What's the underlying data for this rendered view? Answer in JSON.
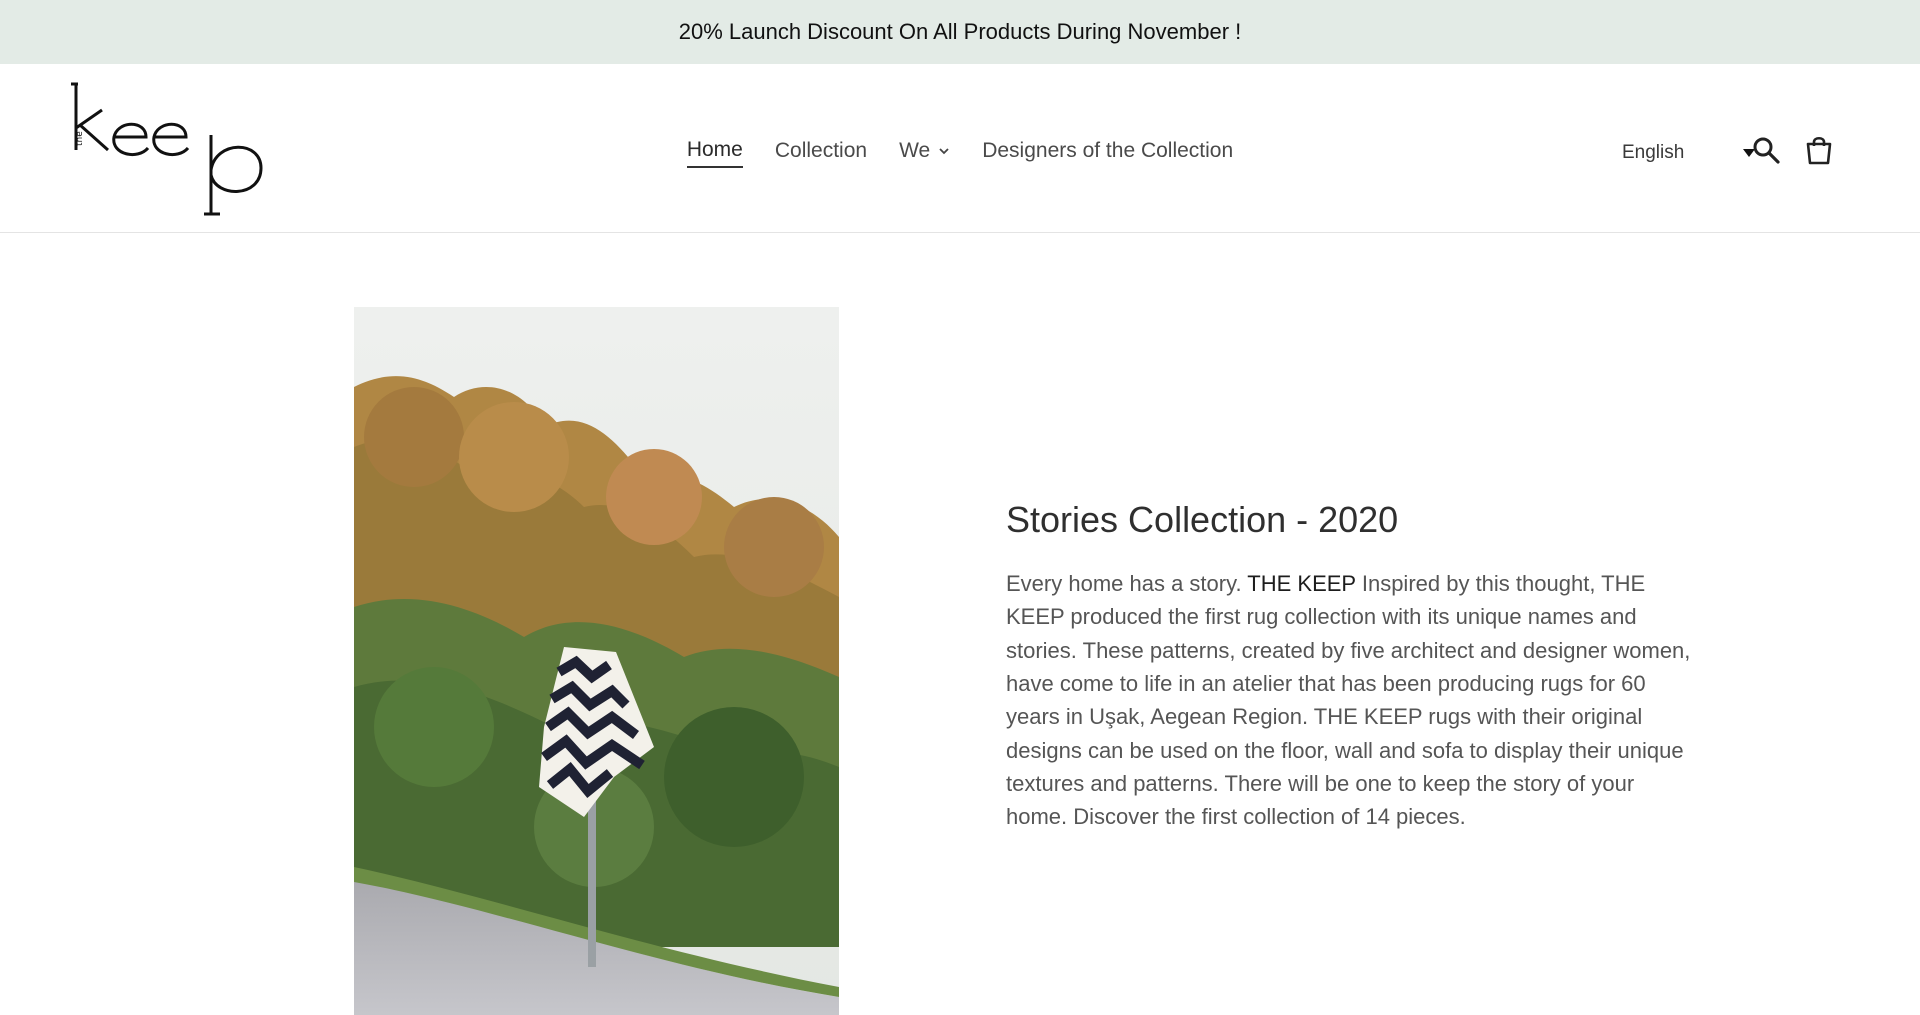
{
  "announcement": {
    "text": "20% Launch Discount On All Products During November !"
  },
  "header": {
    "logo_text": "the keep",
    "nav": [
      {
        "label": "Home",
        "active": true
      },
      {
        "label": "Collection"
      },
      {
        "label": "We",
        "has_dropdown": true
      },
      {
        "label": "Designers of the Collection"
      }
    ],
    "language": "English",
    "icons": [
      "search-icon",
      "cart-icon"
    ]
  },
  "main": {
    "title": "Stories Collection - 2020",
    "body_intro": "Every home has a story.",
    "body_brand": "THE KEEP",
    "body_rest": "Inspired by this thought, THE KEEP produced the first rug collection with its unique names and stories. These patterns, created by five architect and designer women, have come to life in an atelier that has been producing rugs for 60 years in Uşak, Aegean Region. THE KEEP rugs with their original designs can be used on the floor, wall and sofa to display their unique textures and patterns. There will be one to keep the story of your home. Discover the first collection of 14 pieces."
  },
  "colors": {
    "announcement_bg": "#e3ebe6",
    "text": "#3a3a3a"
  }
}
